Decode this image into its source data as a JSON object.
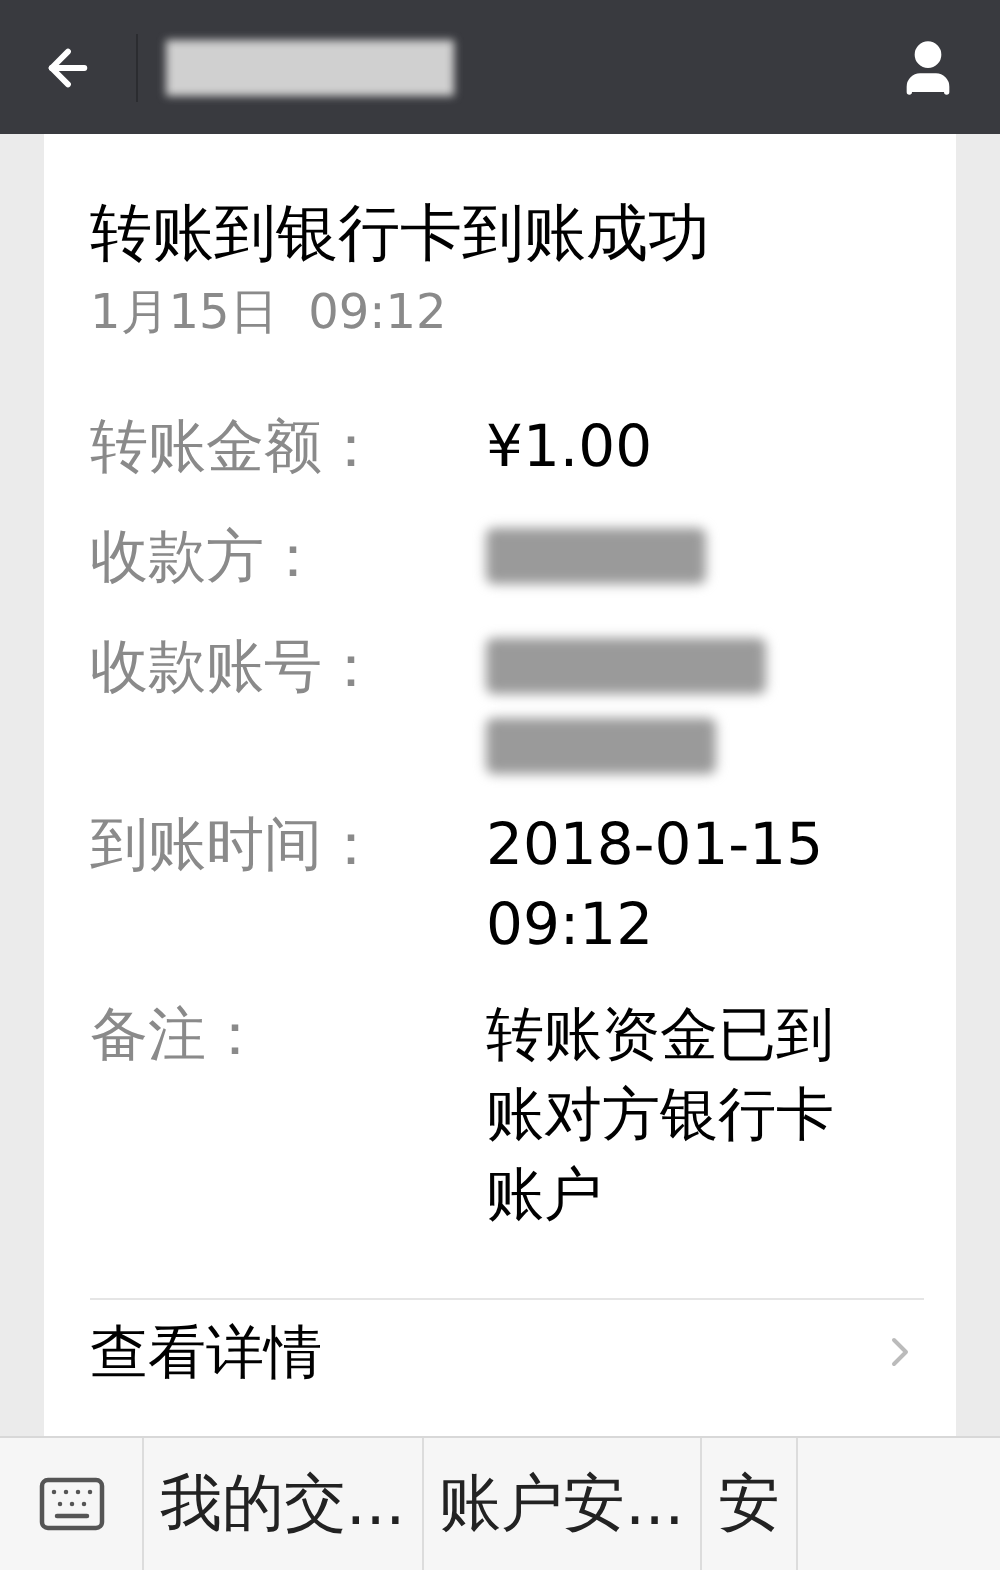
{
  "header": {
    "kind": "redacted"
  },
  "card": {
    "title": "转账到银行卡到账成功",
    "date": "1月15日  09:12",
    "rows": [
      {
        "label": "转账金额：",
        "kind": "text",
        "value": "¥1.00"
      },
      {
        "label": "收款方：",
        "kind": "redacted"
      },
      {
        "label": "收款账号：",
        "kind": "redacted_two_lines"
      },
      {
        "label": "到账时间：",
        "kind": "text",
        "value": "2018-01-15 09:12"
      },
      {
        "label": "备注：",
        "kind": "text",
        "value": "转账资金已到账对方银行卡账户"
      }
    ],
    "details_link": "查看详情"
  },
  "menu_bar": {
    "items": [
      "我的交...",
      "账户安...",
      "安"
    ]
  }
}
